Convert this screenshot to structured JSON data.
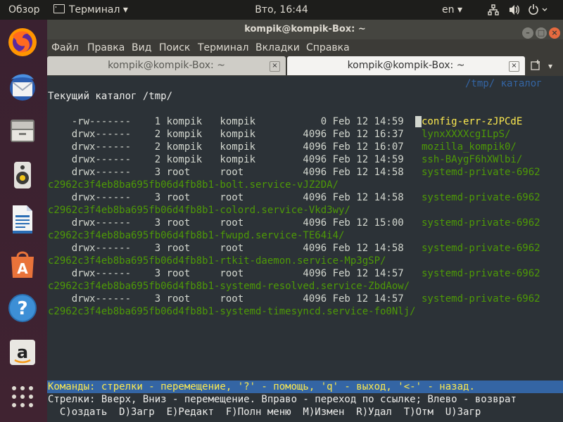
{
  "top_panel": {
    "activities": "Обзор",
    "app_menu": "Терминал",
    "clock": "Вто, 16:44",
    "language": "en"
  },
  "launcher": {
    "items": [
      "firefox-icon",
      "thunderbird-icon",
      "files-icon",
      "rhythmbox-icon",
      "writer-icon",
      "software-icon",
      "help-icon",
      "amazon-icon",
      "apps-grid-icon"
    ]
  },
  "window": {
    "title": "kompik@kompik-Box: ~",
    "menus": [
      "Файл",
      "Правка",
      "Вид",
      "Поиск",
      "Терминал",
      "Вкладки",
      "Справка"
    ],
    "tabs": [
      {
        "label": "kompik@kompik-Box: ~",
        "active": false
      },
      {
        "label": "kompik@kompik-Box: ~",
        "active": true
      }
    ]
  },
  "terminal": {
    "header_right": "/tmp/ каталог",
    "current_dir": "Текущий каталог /tmp/",
    "entries": [
      {
        "perm": "-rw-------",
        "links": "1",
        "owner": "kompik",
        "group": "kompik",
        "size": "0",
        "date": "Feb 12 14:59",
        "name": "config-err-zJPCdE",
        "cont": ""
      },
      {
        "perm": "drwx------",
        "links": "2",
        "owner": "kompik",
        "group": "kompik",
        "size": "4096",
        "date": "Feb 12 16:37",
        "name": "lynxXXXXcgILpS/",
        "cont": ""
      },
      {
        "perm": "drwx------",
        "links": "2",
        "owner": "kompik",
        "group": "kompik",
        "size": "4096",
        "date": "Feb 12 16:07",
        "name": "mozilla_kompik0/",
        "cont": ""
      },
      {
        "perm": "drwx------",
        "links": "2",
        "owner": "kompik",
        "group": "kompik",
        "size": "4096",
        "date": "Feb 12 14:59",
        "name": "ssh-BAygF6hXWlbi/",
        "cont": ""
      },
      {
        "perm": "drwx------",
        "links": "3",
        "owner": "root",
        "group": "root",
        "size": "4096",
        "date": "Feb 12 14:58",
        "name": "systemd-private-6962",
        "cont": "c2962c3f4eb8ba695fb06d4fb8b1-bolt.service-vJZ2DA/"
      },
      {
        "perm": "drwx------",
        "links": "3",
        "owner": "root",
        "group": "root",
        "size": "4096",
        "date": "Feb 12 14:58",
        "name": "systemd-private-6962",
        "cont": "c2962c3f4eb8ba695fb06d4fb8b1-colord.service-Vkd3wy/"
      },
      {
        "perm": "drwx------",
        "links": "3",
        "owner": "root",
        "group": "root",
        "size": "4096",
        "date": "Feb 12 15:00",
        "name": "systemd-private-6962",
        "cont": "c2962c3f4eb8ba695fb06d4fb8b1-fwupd.service-TE64i4/"
      },
      {
        "perm": "drwx------",
        "links": "3",
        "owner": "root",
        "group": "root",
        "size": "4096",
        "date": "Feb 12 14:58",
        "name": "systemd-private-6962",
        "cont": "c2962c3f4eb8ba695fb06d4fb8b1-rtkit-daemon.service-Mp3gSP/"
      },
      {
        "perm": "drwx------",
        "links": "3",
        "owner": "root",
        "group": "root",
        "size": "4096",
        "date": "Feb 12 14:57",
        "name": "systemd-private-6962",
        "cont": "c2962c3f4eb8ba695fb06d4fb8b1-systemd-resolved.service-ZbdAow/"
      },
      {
        "perm": "drwx------",
        "links": "3",
        "owner": "root",
        "group": "root",
        "size": "4096",
        "date": "Feb 12 14:57",
        "name": "systemd-private-6962",
        "cont": "c2962c3f4eb8ba695fb06d4fb8b1-systemd-timesyncd.service-fo0Nlj/"
      }
    ],
    "status_bar": "Команды: стрелки - перемещение, '?' - помощь, 'q' - выход, '<-' - назад.",
    "help_line": "Стрелки: Вверх, Вниз - перемещение. Вправо - переход по ссылке; Влево - возврат",
    "keys_line": "  C)оздать  D)Загр  E)Редакт  F)Полн меню  M)Измен  R)Удал  T)Отм  U)Загр"
  },
  "colors": {
    "terminal_bg": "#2c3237",
    "link_green": "#4e9a06",
    "highlight_yellow": "#fce94f",
    "status_blue": "#3465a4",
    "launcher_bg": "#3d2331"
  }
}
